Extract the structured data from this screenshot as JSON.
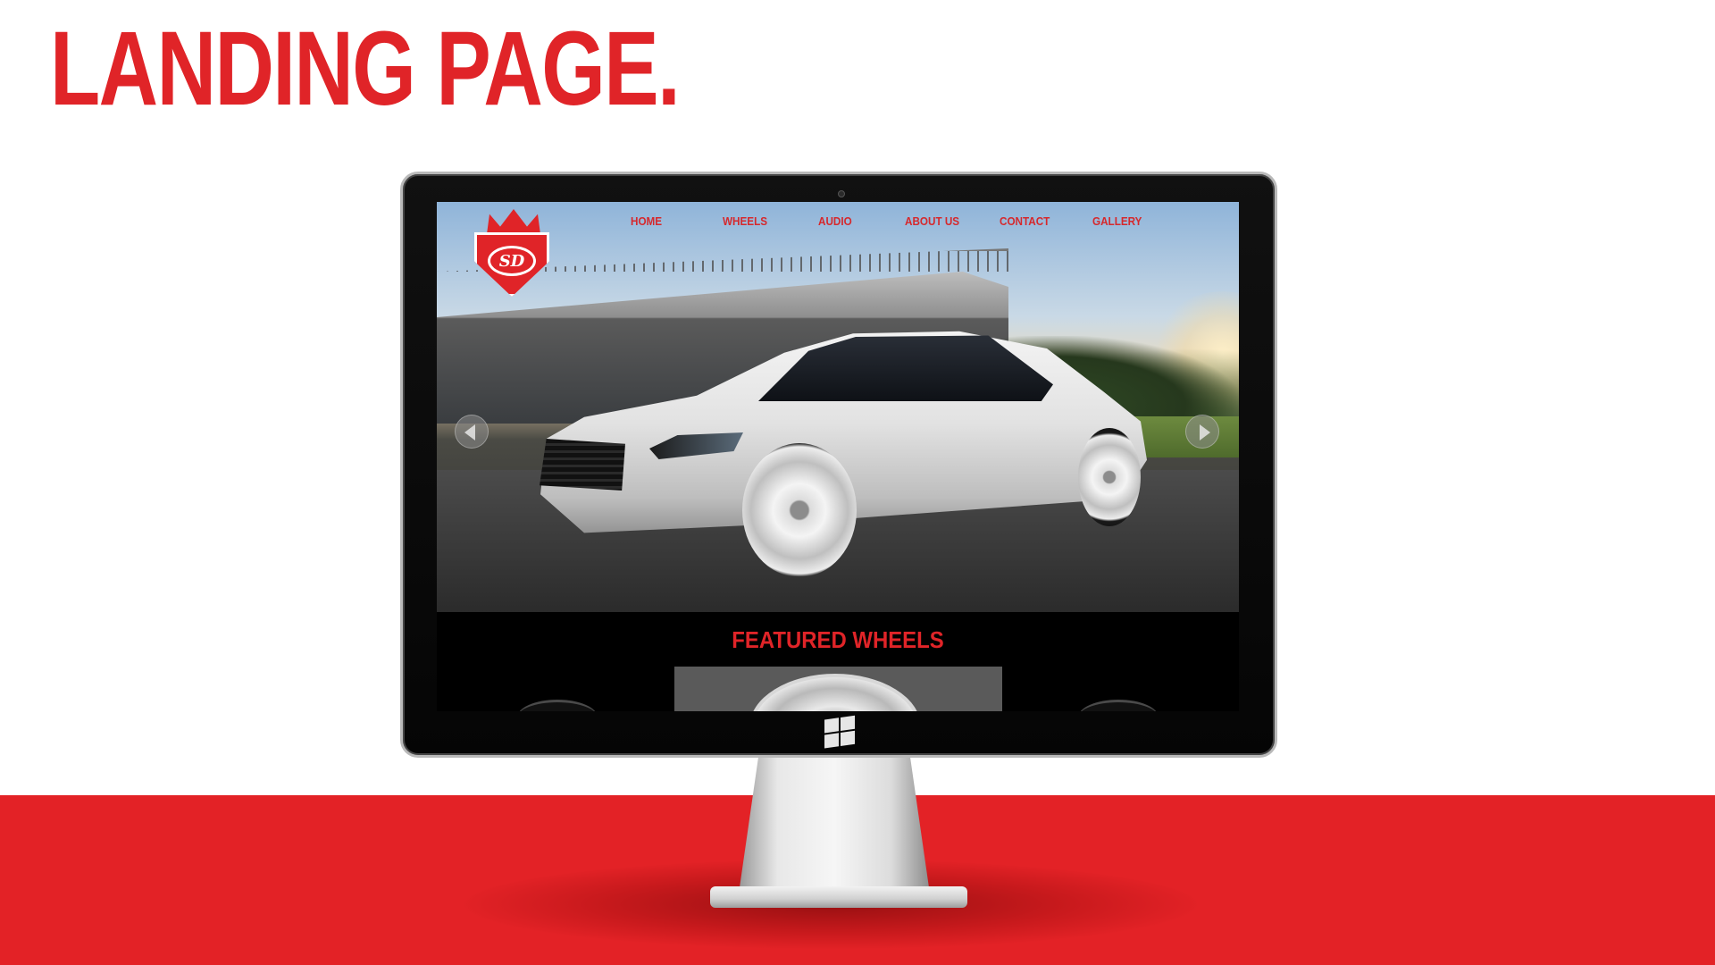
{
  "slide": {
    "title": "LANDING PAGE.",
    "accent_color": "#e02428"
  },
  "website": {
    "logo": {
      "text": "SD",
      "icon": "crown-shield-logo"
    },
    "nav": [
      {
        "label": "HOME"
      },
      {
        "label": "WHEELS"
      },
      {
        "label": "AUDIO"
      },
      {
        "label": "ABOUT US"
      },
      {
        "label": "CONTACT"
      },
      {
        "label": "GALLERY"
      }
    ],
    "hero": {
      "image": "white-sedan-car-photo",
      "prev_icon": "arrow-left-icon",
      "next_icon": "arrow-right-icon"
    },
    "featured": {
      "title": "FEATURED WHEELS"
    }
  },
  "monitor": {
    "brand_icon": "windows-logo-icon"
  }
}
